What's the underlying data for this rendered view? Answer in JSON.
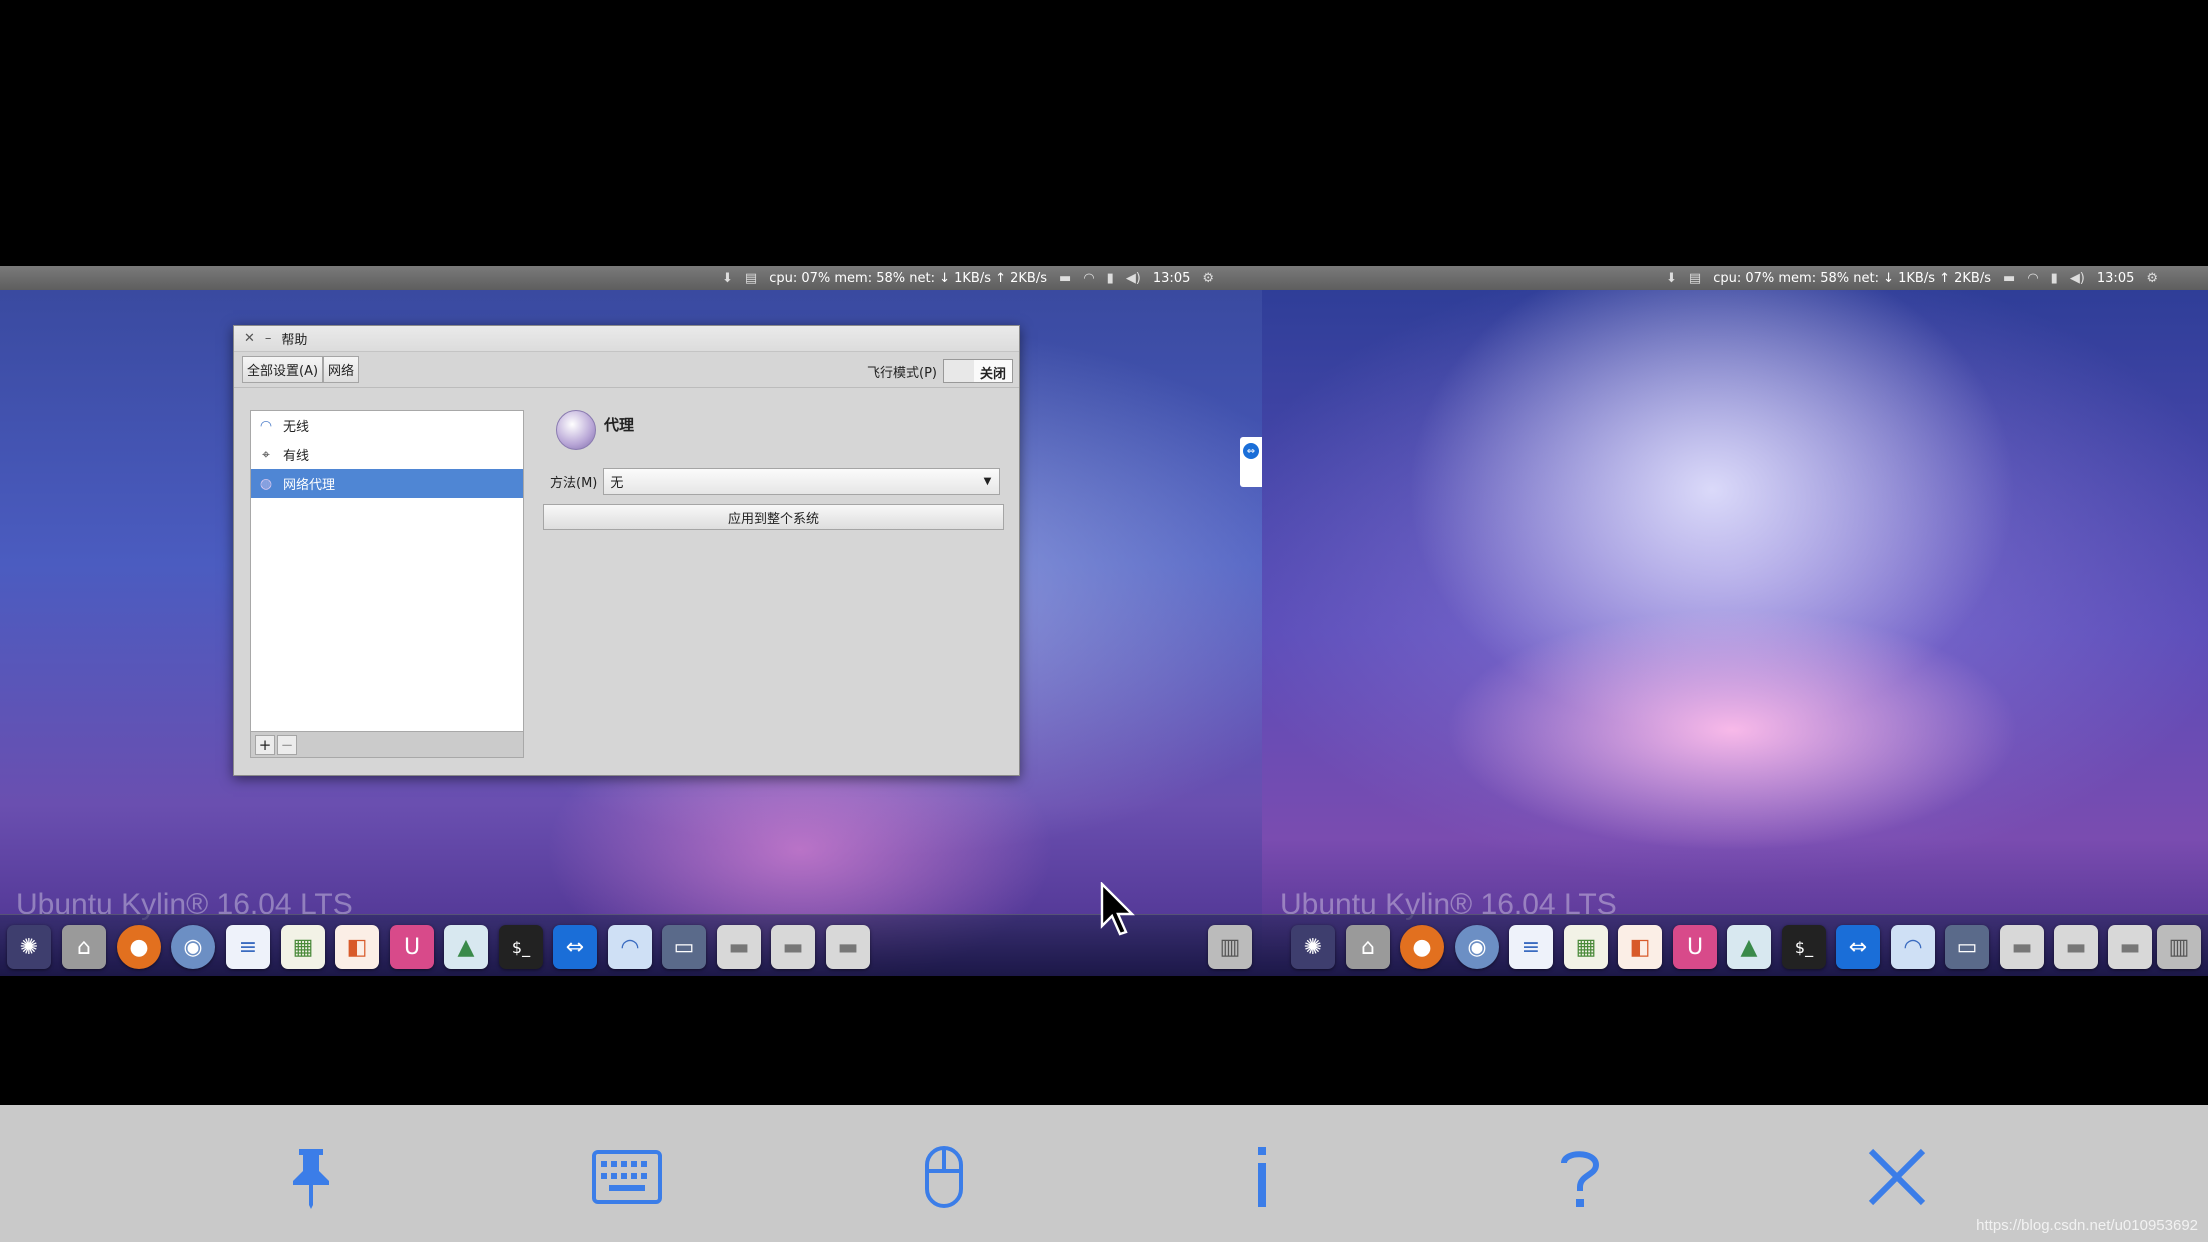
{
  "topbar": {
    "stats": "cpu: 07% mem: 58% net: ↓  1KB/s ↑  2KB/s",
    "clock": "13:05"
  },
  "desktop": {
    "watermark_label": "Ubuntu Kylin® 16.04 LTS"
  },
  "dialog": {
    "title": "帮助",
    "toolbar": {
      "all_settings": "全部设置(A)",
      "network": "网络",
      "airplane_mode": "飞行模式(P)",
      "airplane_state": "关闭"
    },
    "list": [
      {
        "label": "无线",
        "icon": "wifi-icon"
      },
      {
        "label": "有线",
        "icon": "wired-icon"
      },
      {
        "label": "网络代理",
        "icon": "proxy-globe-icon"
      }
    ],
    "add_btn": "+",
    "remove_btn": "−",
    "proxy": {
      "title": "代理",
      "method_label": "方法(M)",
      "method_value": "无",
      "apply_label": "应用到整个系统"
    }
  },
  "dock_apps": [
    "dash-icon",
    "files-icon",
    "firefox-icon",
    "chromium-icon",
    "document-viewer-icon",
    "spreadsheet-icon",
    "presentation-icon",
    "software-center-icon",
    "image-viewer-icon",
    "terminal-icon",
    "teamviewer-icon",
    "network-settings-icon",
    "display-icon",
    "drive-icon",
    "drive-icon",
    "drive-icon",
    "trash-icon"
  ],
  "controls": [
    {
      "name": "pin-icon",
      "glyph": "📌"
    },
    {
      "name": "keyboard-icon",
      "glyph": "⌨"
    },
    {
      "name": "mouse-icon",
      "glyph": "🖱"
    },
    {
      "name": "info-icon",
      "glyph": "i"
    },
    {
      "name": "help-icon",
      "glyph": "?"
    },
    {
      "name": "close-icon",
      "glyph": "✕"
    }
  ],
  "footer_watermark": "https://blog.csdn.net/u010953692",
  "colors": {
    "accent_blue": "#3b7de8",
    "selection": "#4f86d4"
  }
}
